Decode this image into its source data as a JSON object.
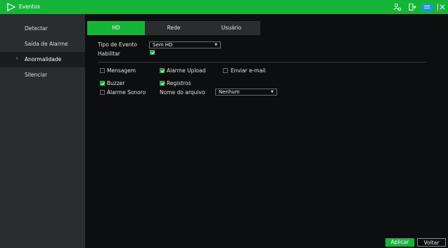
{
  "header": {
    "title": "Eventos"
  },
  "sidebar": {
    "items": [
      {
        "label": "Detectar"
      },
      {
        "label": "Saída de Alarme"
      },
      {
        "label": "Anormalidade",
        "active": true
      },
      {
        "label": "Silenciar"
      }
    ]
  },
  "tabs": [
    {
      "label": "HD",
      "active": true
    },
    {
      "label": "Rede"
    },
    {
      "label": "Usuário"
    }
  ],
  "form": {
    "event_type_label": "Tipo de Evento",
    "event_type_value": "Sem HD",
    "enable_label": "Habilitar",
    "enable_checked": true,
    "message_label": "Mensagem",
    "message_checked": false,
    "alarm_upload_label": "Alarme Upload",
    "alarm_upload_checked": true,
    "email_label": "Enviar e-mail",
    "email_checked": false,
    "buzzer_label": "Buzzer",
    "buzzer_checked": true,
    "logs_label": "Registros",
    "logs_checked": true,
    "alarm_sound_label": "Alarme Sonoro",
    "alarm_sound_checked": false,
    "file_name_label": "Nome do arquivo",
    "file_name_value": "Nenhum"
  },
  "buttons": {
    "apply": "Aplicar",
    "back": "Voltar"
  },
  "colors": {
    "accent": "#15b53a",
    "sidebar_bg": "#2b2c2e",
    "main_bg": "#0d0e0f"
  },
  "icons": [
    "logo-icon",
    "user-settings-icon",
    "logout-icon",
    "menu-icon",
    "close-icon"
  ]
}
